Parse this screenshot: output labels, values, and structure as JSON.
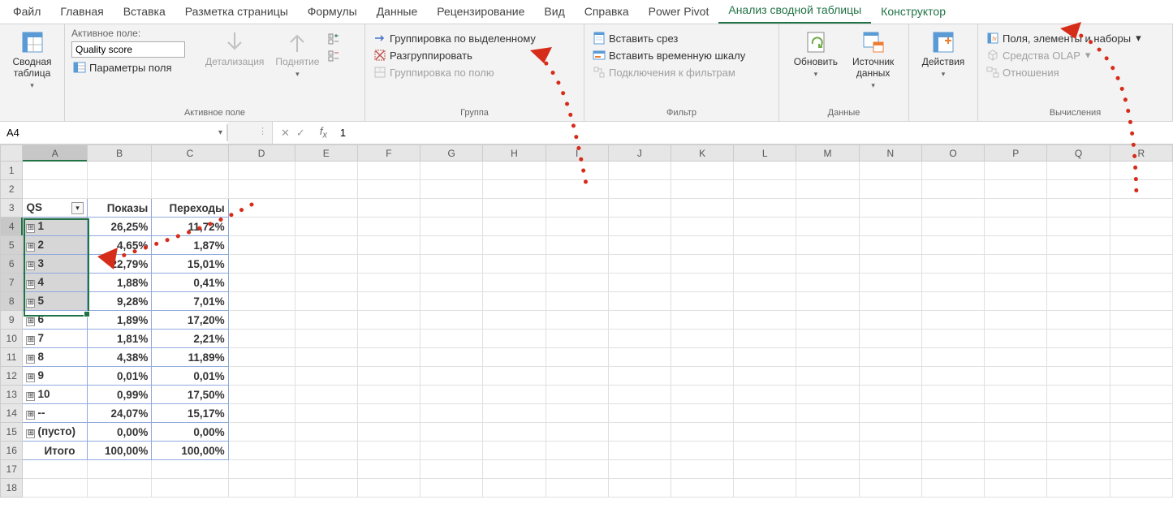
{
  "tabs": [
    "Файл",
    "Главная",
    "Вставка",
    "Разметка страницы",
    "Формулы",
    "Данные",
    "Рецензирование",
    "Вид",
    "Справка",
    "Power Pivot",
    "Анализ сводной таблицы",
    "Конструктор"
  ],
  "active_tab_index": 10,
  "ribbon": {
    "pivot": {
      "btn": "Сводная\nтаблица",
      "title": ""
    },
    "active_field": {
      "label_title": "Активное поле:",
      "field_value": "Quality score",
      "params": "Параметры поля",
      "drill_down": "Детализация",
      "drill_up": "Поднятие",
      "group_label": "Активное поле"
    },
    "group": {
      "by_selection": "Группировка по выделенному",
      "ungroup": "Разгруппировать",
      "by_field": "Группировка по полю",
      "group_label": "Группа"
    },
    "filter": {
      "slicer": "Вставить срез",
      "timeline": "Вставить временную шкалу",
      "connections": "Подключения к фильтрам",
      "group_label": "Фильтр"
    },
    "data": {
      "refresh": "Обновить",
      "source": "Источник\nданных",
      "group_label": "Данные"
    },
    "actions": {
      "btn": "Действия"
    },
    "calc": {
      "fields": "Поля, элементы и наборы",
      "olap": "Средства OLAP",
      "relations": "Отношения",
      "group_label": "Вычисления"
    }
  },
  "namebox": "A4",
  "formula": "1",
  "columns": [
    "A",
    "B",
    "C",
    "D",
    "E",
    "F",
    "G",
    "H",
    "I",
    "J",
    "K",
    "L",
    "M",
    "N",
    "O",
    "P",
    "Q",
    "R"
  ],
  "pivot": {
    "header_col1": "QS",
    "header_col2": "Показы",
    "header_col3": "Переходы",
    "rows": [
      {
        "label": "1",
        "v1": "26,25%",
        "v2": "11,72%"
      },
      {
        "label": "2",
        "v1": "4,65%",
        "v2": "1,87%"
      },
      {
        "label": "3",
        "v1": "22,79%",
        "v2": "15,01%"
      },
      {
        "label": "4",
        "v1": "1,88%",
        "v2": "0,41%"
      },
      {
        "label": "5",
        "v1": "9,28%",
        "v2": "7,01%"
      },
      {
        "label": "6",
        "v1": "1,89%",
        "v2": "17,20%"
      },
      {
        "label": "7",
        "v1": "1,81%",
        "v2": "2,21%"
      },
      {
        "label": "8",
        "v1": "4,38%",
        "v2": "11,89%"
      },
      {
        "label": "9",
        "v1": "0,01%",
        "v2": "0,01%"
      },
      {
        "label": "10",
        "v1": "0,99%",
        "v2": "17,50%"
      },
      {
        "label": "--",
        "v1": "24,07%",
        "v2": "15,17%"
      },
      {
        "label": "(пусто)",
        "v1": "0,00%",
        "v2": "0,00%"
      }
    ],
    "total_label": "Итого",
    "total_v1": "100,00%",
    "total_v2": "100,00%"
  },
  "selected_rows": [
    4,
    5,
    6,
    7,
    8
  ]
}
